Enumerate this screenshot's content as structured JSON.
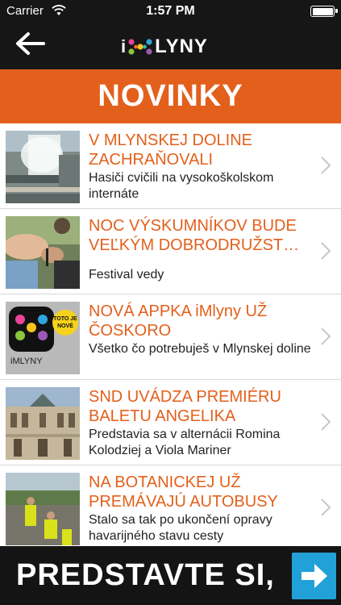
{
  "status": {
    "carrier": "Carrier",
    "time": "1:57 PM"
  },
  "nav": {
    "logo_i": "i",
    "logo_word": "LYNY"
  },
  "header": {
    "title": "NOVINKY"
  },
  "articles": [
    {
      "title": "V MLYNSKEJ DOLINE ZACHRAŇOVALI",
      "desc": "Hasiči cvičili na vysokoškolskom internáte",
      "thumb": "fire-drill-photo"
    },
    {
      "title": "NOC VÝSKUMNÍKOV BUDE VEĽKÝM DOBRODRUŽST…",
      "desc": "Festival vedy",
      "thumb": "science-festival-photo"
    },
    {
      "title": "NOVÁ APPKA iMlyny UŽ ČOSKORO",
      "desc": "Všetko čo potrebuješ v Mlynskej doline",
      "thumb": "imlyny-app-icon",
      "thumb_label": "iMLYNY",
      "thumb_badge": "TOTO JE NOVÉ"
    },
    {
      "title": "SND UVÁDZA PREMIÉRU BALETU ANGELIKA",
      "desc": "Predstavia sa v alternácii Romina Kolodziej a Viola Mariner",
      "thumb": "theatre-building-photo"
    },
    {
      "title": "NA BOTANICKEJ UŽ PREMÁVAJÚ AUTOBUSY",
      "desc": "Stalo sa tak po ukončení opravy havarijného stavu cesty",
      "thumb": "road-repair-photo"
    }
  ],
  "ad": {
    "text": "PREDSTAVTE SI,"
  },
  "colors": {
    "accent": "#e3601c",
    "dark": "#161616",
    "ad_button": "#22a0d8"
  }
}
